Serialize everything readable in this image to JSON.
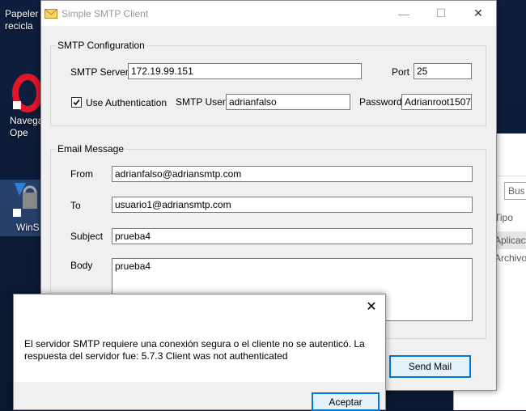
{
  "desktop": {
    "icons": [
      {
        "label": "Papeler\nrecicla"
      },
      {
        "label": "Navega\nOpe"
      },
      {
        "label": "WinS"
      }
    ]
  },
  "background_window": {
    "search_placeholder": "Bus",
    "col_type": "Tipo",
    "row_app": "Aplicac",
    "row_file": "Archivo"
  },
  "window": {
    "title": "Simple SMTP Client",
    "minimize_glyph": "—",
    "maximize_glyph": "☐",
    "close_glyph": "✕"
  },
  "smtp_config": {
    "group_title": "SMTP Configuration",
    "server_label": "SMTP Server",
    "server_value": "172.19.99.151",
    "port_label": "Port",
    "port_value": "25",
    "use_auth_label": "Use Authentication",
    "use_auth_checked": true,
    "user_label": "SMTP User",
    "user_value": "adrianfalso",
    "password_label": "Password",
    "password_value": "Adrianroot1507"
  },
  "email_message": {
    "group_title": "Email Message",
    "from_label": "From",
    "from_value": "adrianfalso@adriansmtp.com",
    "to_label": "To",
    "to_value": "usuario1@adriansmtp.com",
    "subject_label": "Subject",
    "subject_value": "prueba4",
    "body_label": "Body",
    "body_value": "prueba4"
  },
  "send_button_label": "Send Mail",
  "message_box": {
    "close_glyph": "✕",
    "text": "El servidor SMTP requiere una conexión segura o el cliente no se autenticó. La respuesta del servidor fue: 5.7.3 Client was not authenticated",
    "ok_label": "Aceptar"
  }
}
